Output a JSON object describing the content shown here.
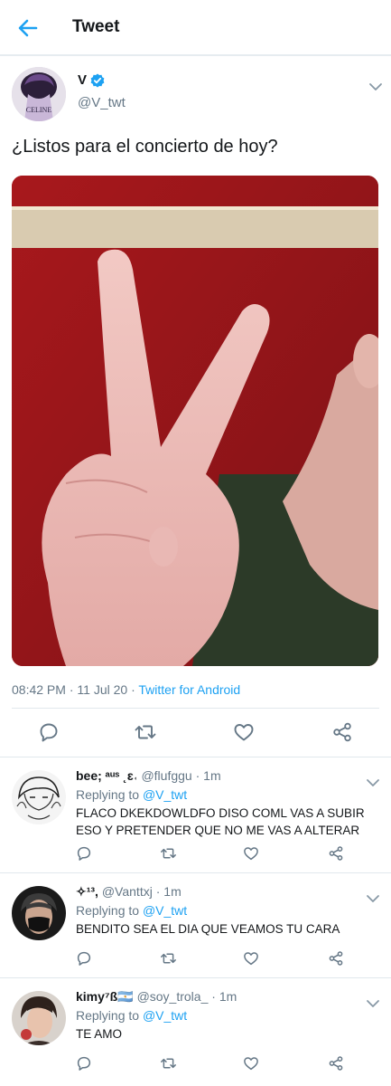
{
  "header": {
    "title": "Tweet"
  },
  "tweet": {
    "author_name": "V",
    "author_handle": "@V_twt",
    "text": "¿Listos para el concierto de hoy?",
    "time": "08:42 PM",
    "date": "11 Jul 20",
    "client": "Twitter for Android",
    "avatar_text": "CELINE"
  },
  "replies": [
    {
      "name": "bee; ᵃᵘˢ ˛ɛ˓",
      "handle": "@flufggu",
      "time": "1m",
      "replying_label": "Replying to",
      "replying_to": "@V_twt",
      "text": "FLACO DKEKDOWLDFO DISO COML VAS A SUBIR ESO Y PRETENDER QUE NO ME VAS A ALTERAR"
    },
    {
      "name": "✧¹³,",
      "handle": "@Vanttxj",
      "time": "1m",
      "replying_label": "Replying to",
      "replying_to": "@V_twt",
      "text": "BENDITO SEA EL DIA QUE VEAMOS TU CARA"
    },
    {
      "name": "kimy⁷ß🇦🇷",
      "handle": "@soy_trola_",
      "time": "1m",
      "replying_label": "Replying to",
      "replying_to": "@V_twt",
      "text": "TE AMO"
    }
  ],
  "separator": "·",
  "colors": {
    "accent": "#1da1f2",
    "secondary_text": "#657786",
    "divider": "#e1e8ed",
    "photo_wall": "#9a1c1e"
  },
  "icons": {
    "back": "back-arrow-icon",
    "verified": "verified-badge-icon",
    "more": "chevron-down-icon",
    "reply": "reply-icon",
    "retweet": "retweet-icon",
    "like": "heart-icon",
    "share": "share-icon"
  }
}
